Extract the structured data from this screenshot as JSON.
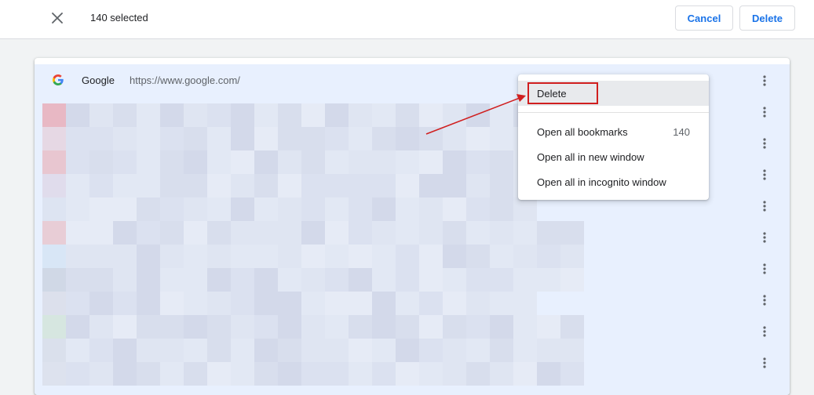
{
  "toolbar": {
    "selected_text": "140 selected",
    "cancel_label": "Cancel",
    "delete_label": "Delete"
  },
  "bookmark": {
    "title": "Google",
    "url": "https://www.google.com/"
  },
  "context_menu": {
    "items": [
      {
        "label": "Delete"
      },
      {
        "label": "Open all bookmarks",
        "count": "140"
      },
      {
        "label": "Open all in new window"
      },
      {
        "label": "Open all in incognito window"
      }
    ]
  },
  "colors": {
    "accent": "#1a73e8",
    "selected_row": "#e8f0fe",
    "annotation": "#d01f1f"
  }
}
